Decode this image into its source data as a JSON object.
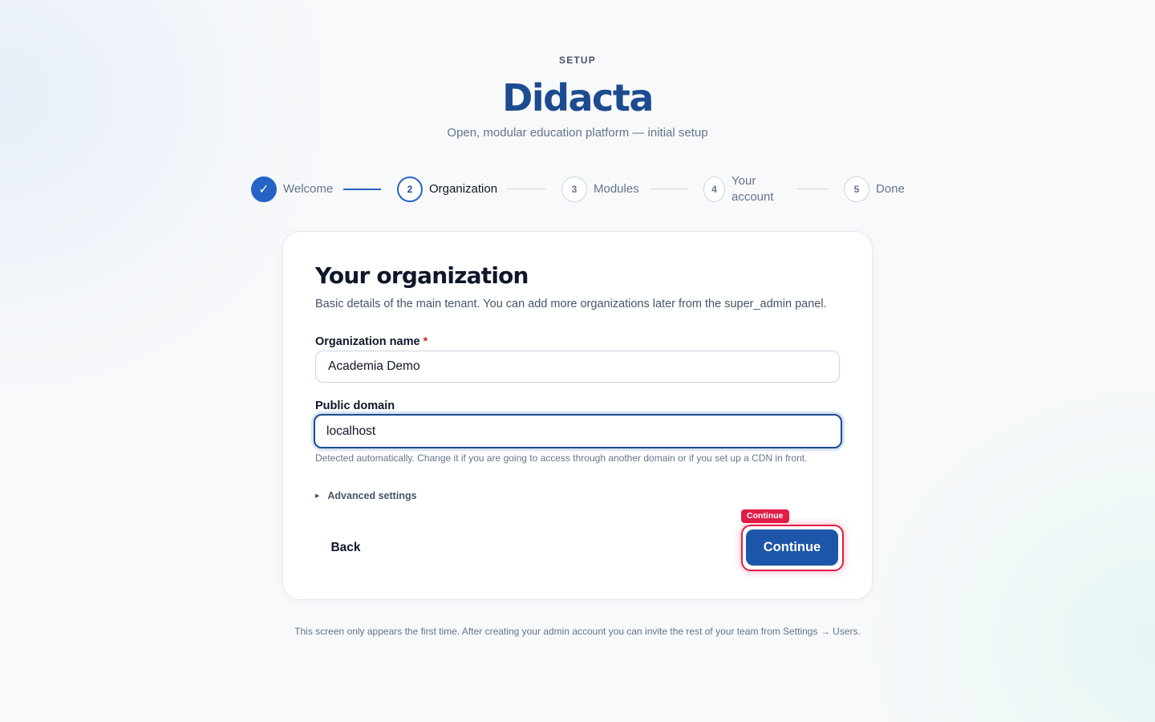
{
  "header": {
    "eyebrow": "SETUP",
    "brand": "Didacta",
    "tagline": "Open, modular education platform — initial setup"
  },
  "steps": [
    {
      "number": "✓",
      "label": "Welcome",
      "state": "done"
    },
    {
      "number": "2",
      "label": "Organization",
      "state": "active"
    },
    {
      "number": "3",
      "label": "Modules",
      "state": "pending"
    },
    {
      "number": "4",
      "label": "Your account",
      "label_lines": [
        "Your",
        "account"
      ],
      "state": "pending"
    },
    {
      "number": "5",
      "label": "Done",
      "state": "pending"
    }
  ],
  "card": {
    "title": "Your organization",
    "description": "Basic details of the main tenant. You can add more organizations later from the super_admin panel.",
    "org_name": {
      "label": "Organization name",
      "required_mark": "*",
      "value": "Academia Demo"
    },
    "domain": {
      "label": "Public domain",
      "value": "localhost",
      "hint": "Detected automatically. Change it if you are going to access through another domain or if you set up a CDN in front."
    },
    "advanced_label": "Advanced settings",
    "back_label": "Back",
    "continue_label": "Continue",
    "continue_tag": "Continue"
  },
  "footnote": "This screen only appears the first time. After creating your admin account you can invite the rest of your team from Settings → Users.",
  "colors": {
    "brand": "#1c4b8f",
    "primary": "#1c56a8",
    "step_active": "#2563c4",
    "highlight": "#e11d48",
    "required": "#dc2626"
  }
}
